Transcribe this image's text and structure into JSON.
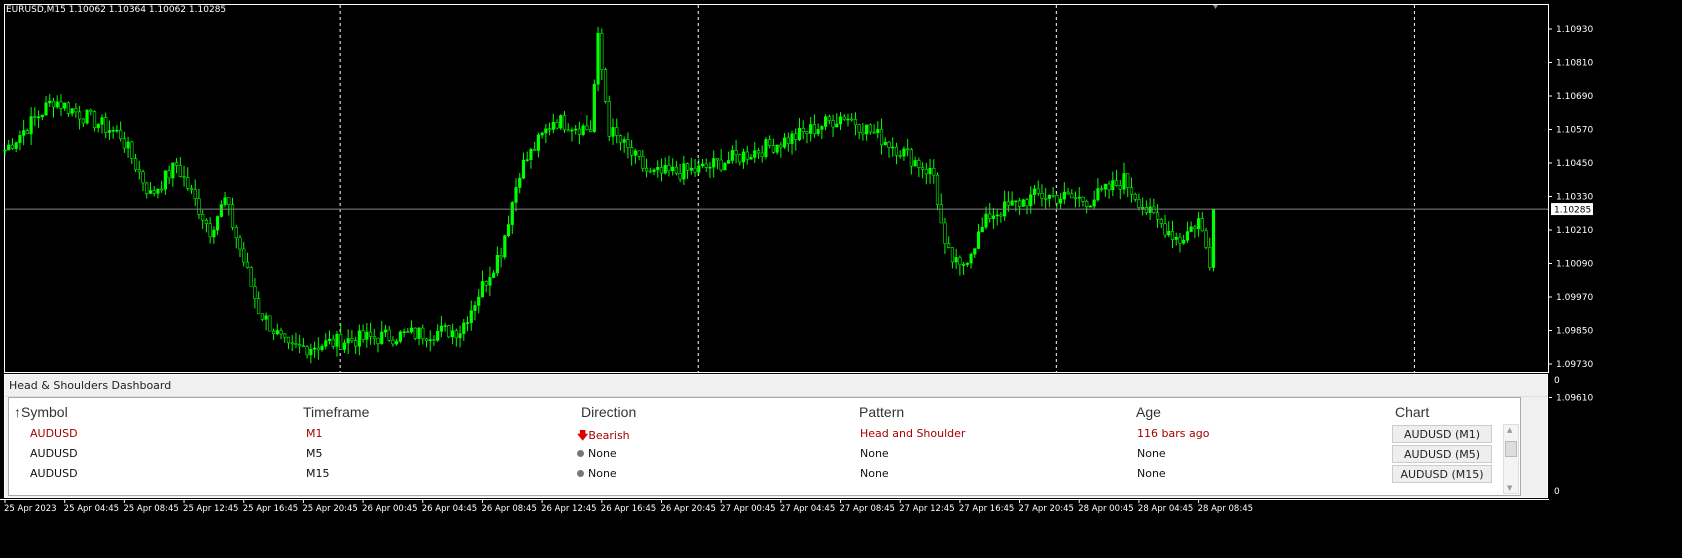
{
  "window": {
    "title": "EURUSD,M15  1.10062 1.10364 1.10062 1.10285"
  },
  "chart_data": {
    "type": "candlestick",
    "symbol": "EURUSD",
    "timeframe": "M15",
    "ohlc_header": {
      "open": 1.10062,
      "high": 1.10364,
      "low": 1.10062,
      "close": 1.10285
    },
    "current_price": "1.10285",
    "ylim": [
      1.0958,
      1.1098
    ],
    "y_ticks": [
      "1.10930",
      "1.10810",
      "1.10690",
      "1.10570",
      "1.10450",
      "1.10330",
      "1.10210",
      "1.10090",
      "1.09970",
      "1.09850",
      "1.09730",
      "1.09610"
    ],
    "x_ticks": [
      "25 Apr 2023",
      "25 Apr 04:45",
      "25 Apr 08:45",
      "25 Apr 12:45",
      "25 Apr 16:45",
      "25 Apr 20:45",
      "26 Apr 00:45",
      "26 Apr 04:45",
      "26 Apr 08:45",
      "26 Apr 12:45",
      "26 Apr 16:45",
      "26 Apr 20:45",
      "27 Apr 00:45",
      "27 Apr 04:45",
      "27 Apr 08:45",
      "27 Apr 12:45",
      "27 Apr 16:45",
      "27 Apr 20:45",
      "28 Apr 00:45",
      "28 Apr 04:45",
      "28 Apr 08:45"
    ],
    "bars_per_tick": 16,
    "day_separators_bar": [
      92,
      188,
      284,
      380
    ],
    "close_path_anchors": [
      [
        0,
        1.10497
      ],
      [
        13,
        1.10676
      ],
      [
        31,
        1.1055
      ],
      [
        39,
        1.10335
      ],
      [
        46,
        1.10443
      ],
      [
        55,
        1.1021
      ],
      [
        59,
        1.10317
      ],
      [
        68,
        1.09924
      ],
      [
        76,
        1.0978
      ],
      [
        92,
        1.09816
      ],
      [
        122,
        1.09852
      ],
      [
        133,
        1.10138
      ],
      [
        138,
        1.10425
      ],
      [
        147,
        1.10604
      ],
      [
        157,
        1.1057
      ],
      [
        159,
        1.1089
      ],
      [
        162,
        1.10568
      ],
      [
        173,
        1.10407
      ],
      [
        186,
        1.10425
      ],
      [
        202,
        1.10497
      ],
      [
        213,
        1.1055
      ],
      [
        225,
        1.10622
      ],
      [
        240,
        1.10497
      ],
      [
        249,
        1.10407
      ],
      [
        252,
        1.10138
      ],
      [
        256,
        1.10067
      ],
      [
        264,
        1.10264
      ],
      [
        277,
        1.10335
      ],
      [
        291,
        1.10317
      ],
      [
        300,
        1.10389
      ],
      [
        307,
        1.10264
      ],
      [
        315,
        1.10174
      ],
      [
        320,
        1.10246
      ],
      [
        323,
        1.101
      ],
      [
        324,
        1.10285
      ]
    ],
    "bull_color": "#00ff00",
    "bear_color": "#ffffff"
  },
  "dashboard": {
    "title": "Head & Shoulders Dashboard",
    "scale_top": "0",
    "scale_bottom": "0",
    "columns": [
      "Symbol",
      "Timeframe",
      "Direction",
      "Pattern",
      "Age",
      "Chart"
    ],
    "sort_arrow": "↑",
    "rows": [
      {
        "symbol": "AUDUSD",
        "timeframe": "M1",
        "direction": "Bearish",
        "pattern": "Head and Shoulder",
        "age": "116 bars ago",
        "chart": "AUDUSD (M1)",
        "highlight": true
      },
      {
        "symbol": "AUDUSD",
        "timeframe": "M5",
        "direction": "None",
        "pattern": "None",
        "age": "None",
        "chart": "AUDUSD (M5)",
        "highlight": false
      },
      {
        "symbol": "AUDUSD",
        "timeframe": "M15",
        "direction": "None",
        "pattern": "None",
        "age": "None",
        "chart": "AUDUSD (M15)",
        "highlight": false
      }
    ]
  }
}
